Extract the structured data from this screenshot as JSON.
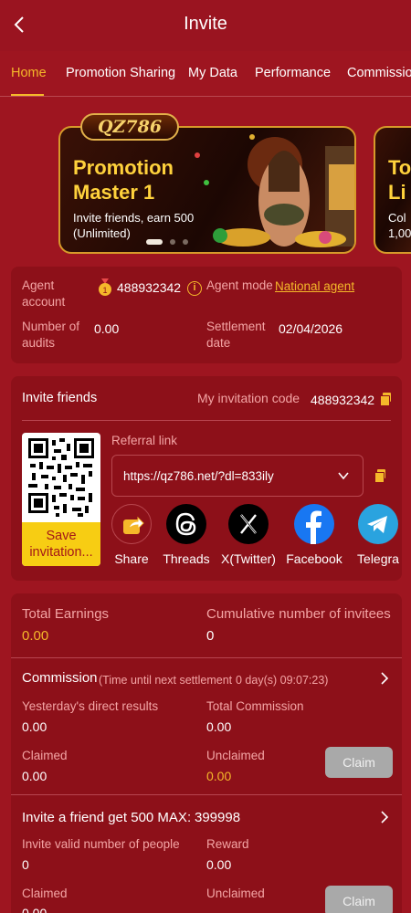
{
  "header": {
    "title": "Invite"
  },
  "tabs": [
    "Home",
    "Promotion Sharing",
    "My Data",
    "Performance",
    "Commissio"
  ],
  "banners": [
    {
      "logo": "QZ786",
      "title": "Promotion Master 1",
      "subtitle": "Invite friends, earn 500 (Unlimited)"
    },
    {
      "title": "To Li",
      "subtitle": "Col 1,00"
    }
  ],
  "agent": {
    "account_label": "Agent account",
    "account_value": "488932342",
    "mode_label": "Agent mode",
    "mode_value": "National agent",
    "audits_label": "Number of audits",
    "audits_value": "0.00",
    "settlement_label": "Settlement date",
    "settlement_value": "02/04/2026"
  },
  "invite": {
    "title": "Invite friends",
    "code_label": "My invitation code",
    "code_value": "488932342",
    "save_label": "Save invitation...",
    "referral_label": "Referral link",
    "referral_url": "https://qz786.net/?dl=833ily",
    "share_targets": [
      {
        "label": "Share",
        "icon": "share-icon"
      },
      {
        "label": "Threads",
        "icon": "threads-icon"
      },
      {
        "label": "X(Twitter)",
        "icon": "x-twitter-icon"
      },
      {
        "label": "Facebook",
        "icon": "facebook-icon"
      },
      {
        "label": "Telegra",
        "icon": "telegram-icon"
      }
    ]
  },
  "earnings": {
    "total_label": "Total Earnings",
    "total_value": "0.00",
    "invitees_label": "Cumulative number of invitees",
    "invitees_value": "0"
  },
  "commission": {
    "title": "Commission",
    "countdown_prefix": "(Time until next settlement",
    "countdown_value": "0 day(s) 09:07:23)",
    "yesterday_label": "Yesterday's direct results",
    "yesterday_value": "0.00",
    "total_label": "Total Commission",
    "total_value": "0.00",
    "claimed_label": "Claimed",
    "claimed_value": "0.00",
    "unclaimed_label": "Unclaimed",
    "unclaimed_value": "0.00",
    "claim_button": "Claim"
  },
  "invite_reward": {
    "title": "Invite a friend get 500 MAX:",
    "title_value": "399998",
    "valid_label": "Invite valid number of people",
    "valid_value": "0",
    "reward_label": "Reward",
    "reward_value": "0.00",
    "claimed_label": "Claimed",
    "claimed_value": "0.00",
    "unclaimed_label": "Unclaimed",
    "claim_button": "Claim"
  },
  "colors": {
    "background": "#9e1520",
    "card": "#8d1019",
    "accent": "#f5b82a",
    "label": "#f4a5a5",
    "save_button": "#f7cd13"
  }
}
